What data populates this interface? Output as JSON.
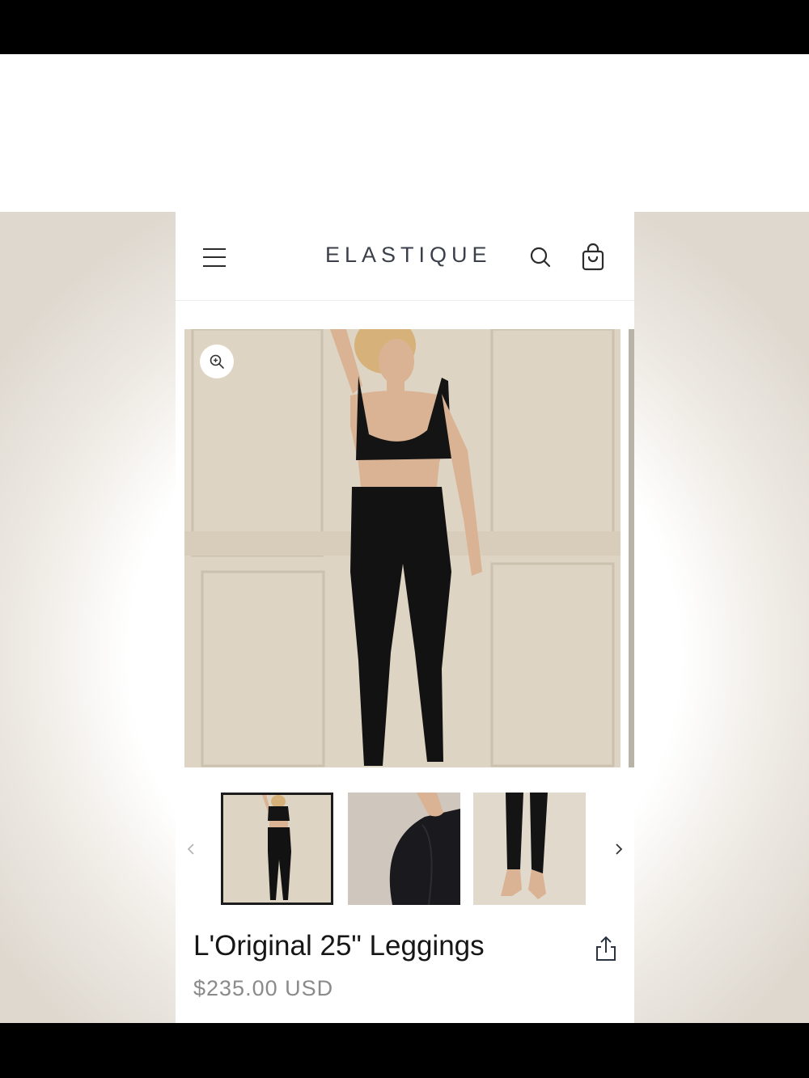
{
  "header": {
    "brand": "ELASTIQUE",
    "icons": [
      "menu-icon",
      "search-icon",
      "cart-icon"
    ]
  },
  "gallery": {
    "zoom_icon": "zoom-in-icon",
    "thumbnails": [
      {
        "subject": "full-body-front",
        "selected": true
      },
      {
        "subject": "rear-detail",
        "selected": false
      },
      {
        "subject": "legs-detail",
        "selected": false
      }
    ],
    "prev_icon": "chevron-left-icon",
    "next_icon": "chevron-right-icon"
  },
  "product": {
    "title": "L'Original 25\" Leggings",
    "price": "$235.00 USD",
    "share_icon": "share-icon"
  },
  "colors": {
    "text_dark": "#161616",
    "price_gray": "#8a8a8a",
    "brand_slate": "#3a3f4a",
    "photo_backdrop": "#ddd4c3"
  }
}
